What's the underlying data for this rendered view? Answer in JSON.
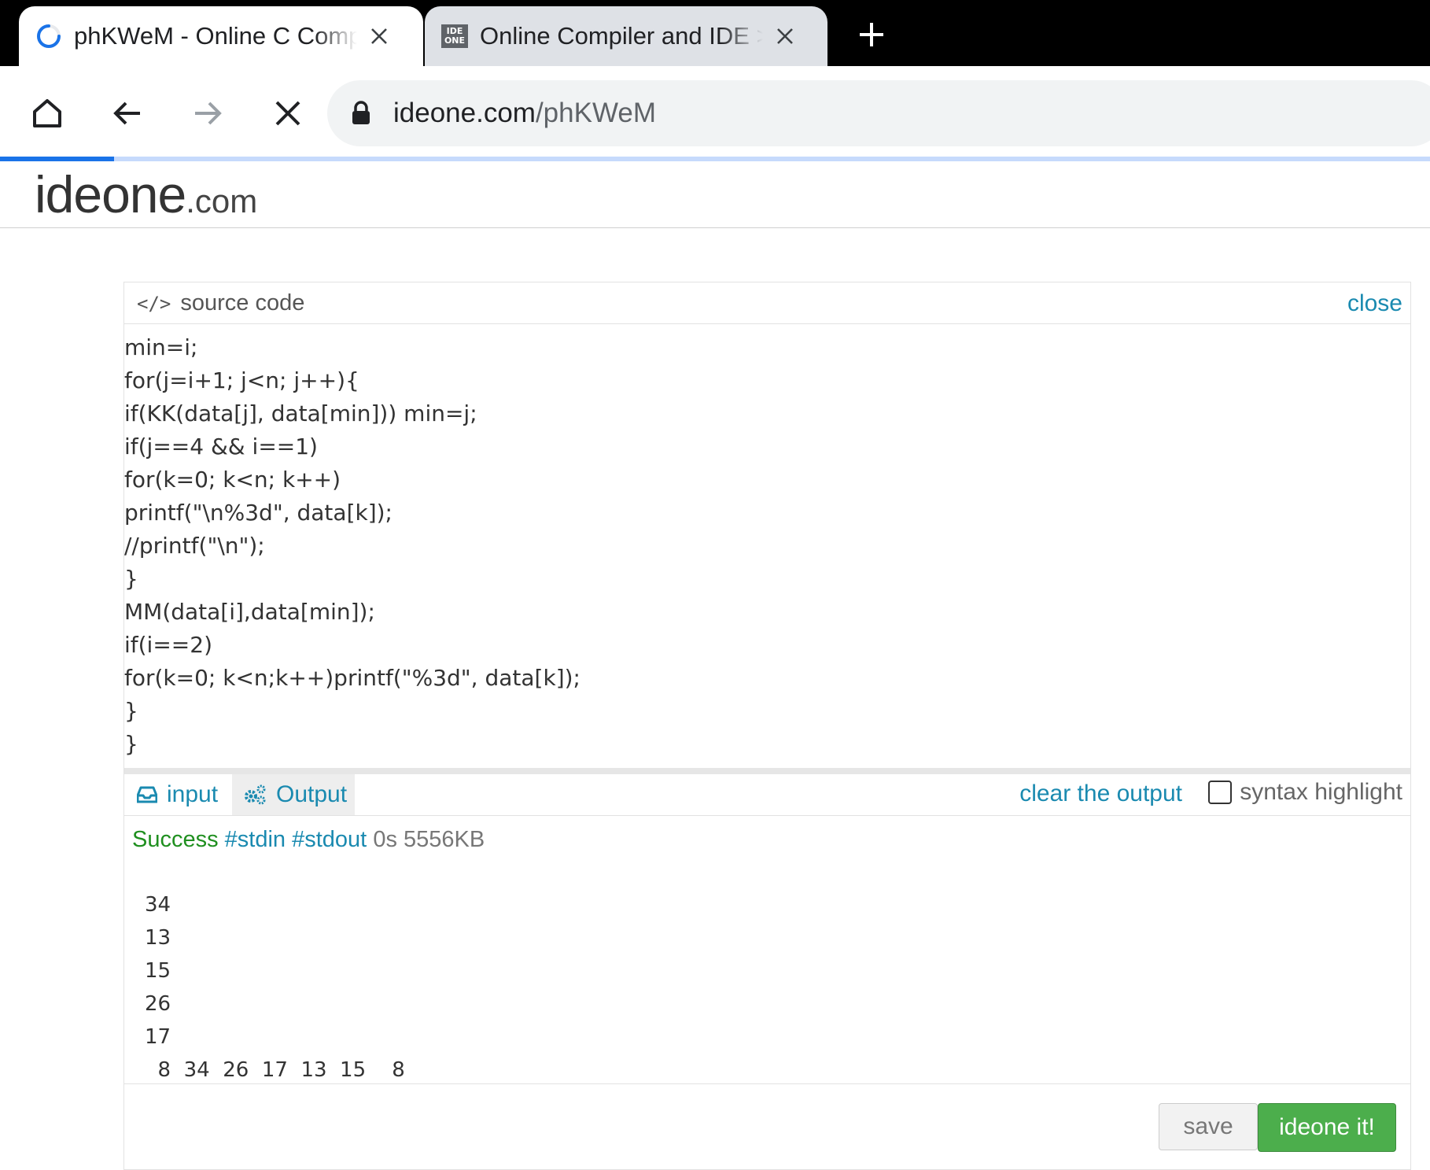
{
  "browser": {
    "tabs": [
      {
        "title": "phKWeM - Online C Compiler",
        "active": true,
        "favicon": "loading-spinner-icon"
      },
      {
        "title": "Online Compiler and IDE >> C",
        "active": false,
        "favicon": "ideone-favicon",
        "favicon_text": [
          "IDE",
          "ONE"
        ]
      }
    ],
    "url_host": "ideone.com",
    "url_path": "/phKWeM",
    "load_progress": 0.08
  },
  "site": {
    "logo_main": "ideone",
    "logo_tld": ".com"
  },
  "source": {
    "title": "source code",
    "close_label": "close",
    "lines": [
      "min=i;",
      "for(j=i+1; j<n; j++){",
      "if(KK(data[j], data[min])) min=j;",
      "if(j==4 && i==1)",
      "for(k=0; k<n; k++)",
      "printf(\"\\n%3d\", data[k]);",
      "//printf(\"\\n\");",
      "}",
      "MM(data[i],data[min]);",
      "if(i==2)",
      "for(k=0; k<n;k++)printf(\"%3d\", data[k]);",
      "}",
      "}"
    ]
  },
  "io": {
    "input_label": "input",
    "output_label": "Output",
    "clear_label": "clear the output",
    "syntax_label": "syntax highlight"
  },
  "result": {
    "status": "Success",
    "tags": "#stdin #stdout",
    "meta": "0s 5556KB",
    "output_lines": [
      "34",
      "13",
      "15",
      "26",
      "17",
      "  8  34  26  17  13  15    8"
    ]
  },
  "actions": {
    "save_label": "save",
    "run_label": "ideone it!"
  },
  "colors": {
    "link": "#1a8ab0",
    "success": "#1f8f1f",
    "run_button": "#4cae4c"
  }
}
